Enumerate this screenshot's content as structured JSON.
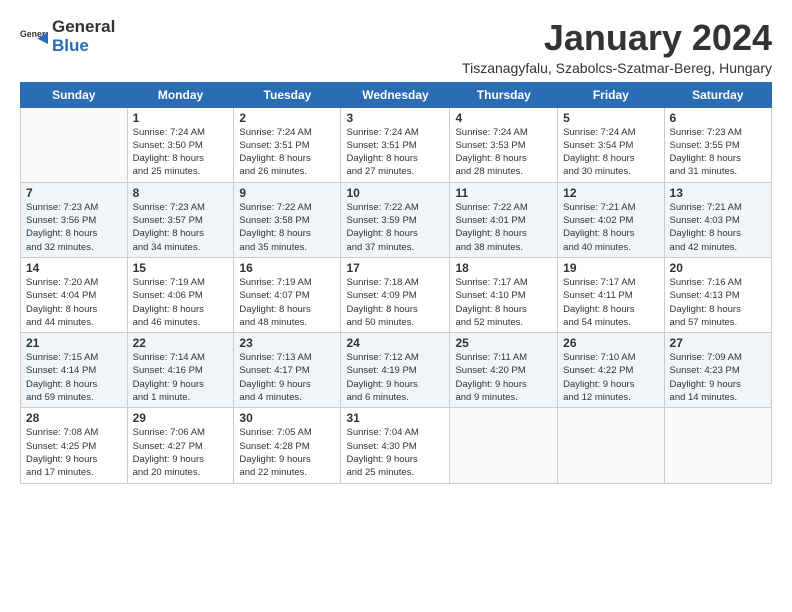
{
  "logo": {
    "general": "General",
    "blue": "Blue"
  },
  "title": "January 2024",
  "subtitle": "Tiszanagyfalu, Szabolcs-Szatmar-Bereg, Hungary",
  "days_of_week": [
    "Sunday",
    "Monday",
    "Tuesday",
    "Wednesday",
    "Thursday",
    "Friday",
    "Saturday"
  ],
  "weeks": [
    [
      {
        "day": "",
        "info": ""
      },
      {
        "day": "1",
        "info": "Sunrise: 7:24 AM\nSunset: 3:50 PM\nDaylight: 8 hours\nand 25 minutes."
      },
      {
        "day": "2",
        "info": "Sunrise: 7:24 AM\nSunset: 3:51 PM\nDaylight: 8 hours\nand 26 minutes."
      },
      {
        "day": "3",
        "info": "Sunrise: 7:24 AM\nSunset: 3:51 PM\nDaylight: 8 hours\nand 27 minutes."
      },
      {
        "day": "4",
        "info": "Sunrise: 7:24 AM\nSunset: 3:53 PM\nDaylight: 8 hours\nand 28 minutes."
      },
      {
        "day": "5",
        "info": "Sunrise: 7:24 AM\nSunset: 3:54 PM\nDaylight: 8 hours\nand 30 minutes."
      },
      {
        "day": "6",
        "info": "Sunrise: 7:23 AM\nSunset: 3:55 PM\nDaylight: 8 hours\nand 31 minutes."
      }
    ],
    [
      {
        "day": "7",
        "info": "Sunrise: 7:23 AM\nSunset: 3:56 PM\nDaylight: 8 hours\nand 32 minutes."
      },
      {
        "day": "8",
        "info": "Sunrise: 7:23 AM\nSunset: 3:57 PM\nDaylight: 8 hours\nand 34 minutes."
      },
      {
        "day": "9",
        "info": "Sunrise: 7:22 AM\nSunset: 3:58 PM\nDaylight: 8 hours\nand 35 minutes."
      },
      {
        "day": "10",
        "info": "Sunrise: 7:22 AM\nSunset: 3:59 PM\nDaylight: 8 hours\nand 37 minutes."
      },
      {
        "day": "11",
        "info": "Sunrise: 7:22 AM\nSunset: 4:01 PM\nDaylight: 8 hours\nand 38 minutes."
      },
      {
        "day": "12",
        "info": "Sunrise: 7:21 AM\nSunset: 4:02 PM\nDaylight: 8 hours\nand 40 minutes."
      },
      {
        "day": "13",
        "info": "Sunrise: 7:21 AM\nSunset: 4:03 PM\nDaylight: 8 hours\nand 42 minutes."
      }
    ],
    [
      {
        "day": "14",
        "info": "Sunrise: 7:20 AM\nSunset: 4:04 PM\nDaylight: 8 hours\nand 44 minutes."
      },
      {
        "day": "15",
        "info": "Sunrise: 7:19 AM\nSunset: 4:06 PM\nDaylight: 8 hours\nand 46 minutes."
      },
      {
        "day": "16",
        "info": "Sunrise: 7:19 AM\nSunset: 4:07 PM\nDaylight: 8 hours\nand 48 minutes."
      },
      {
        "day": "17",
        "info": "Sunrise: 7:18 AM\nSunset: 4:09 PM\nDaylight: 8 hours\nand 50 minutes."
      },
      {
        "day": "18",
        "info": "Sunrise: 7:17 AM\nSunset: 4:10 PM\nDaylight: 8 hours\nand 52 minutes."
      },
      {
        "day": "19",
        "info": "Sunrise: 7:17 AM\nSunset: 4:11 PM\nDaylight: 8 hours\nand 54 minutes."
      },
      {
        "day": "20",
        "info": "Sunrise: 7:16 AM\nSunset: 4:13 PM\nDaylight: 8 hours\nand 57 minutes."
      }
    ],
    [
      {
        "day": "21",
        "info": "Sunrise: 7:15 AM\nSunset: 4:14 PM\nDaylight: 8 hours\nand 59 minutes."
      },
      {
        "day": "22",
        "info": "Sunrise: 7:14 AM\nSunset: 4:16 PM\nDaylight: 9 hours\nand 1 minute."
      },
      {
        "day": "23",
        "info": "Sunrise: 7:13 AM\nSunset: 4:17 PM\nDaylight: 9 hours\nand 4 minutes."
      },
      {
        "day": "24",
        "info": "Sunrise: 7:12 AM\nSunset: 4:19 PM\nDaylight: 9 hours\nand 6 minutes."
      },
      {
        "day": "25",
        "info": "Sunrise: 7:11 AM\nSunset: 4:20 PM\nDaylight: 9 hours\nand 9 minutes."
      },
      {
        "day": "26",
        "info": "Sunrise: 7:10 AM\nSunset: 4:22 PM\nDaylight: 9 hours\nand 12 minutes."
      },
      {
        "day": "27",
        "info": "Sunrise: 7:09 AM\nSunset: 4:23 PM\nDaylight: 9 hours\nand 14 minutes."
      }
    ],
    [
      {
        "day": "28",
        "info": "Sunrise: 7:08 AM\nSunset: 4:25 PM\nDaylight: 9 hours\nand 17 minutes."
      },
      {
        "day": "29",
        "info": "Sunrise: 7:06 AM\nSunset: 4:27 PM\nDaylight: 9 hours\nand 20 minutes."
      },
      {
        "day": "30",
        "info": "Sunrise: 7:05 AM\nSunset: 4:28 PM\nDaylight: 9 hours\nand 22 minutes."
      },
      {
        "day": "31",
        "info": "Sunrise: 7:04 AM\nSunset: 4:30 PM\nDaylight: 9 hours\nand 25 minutes."
      },
      {
        "day": "",
        "info": ""
      },
      {
        "day": "",
        "info": ""
      },
      {
        "day": "",
        "info": ""
      }
    ]
  ]
}
